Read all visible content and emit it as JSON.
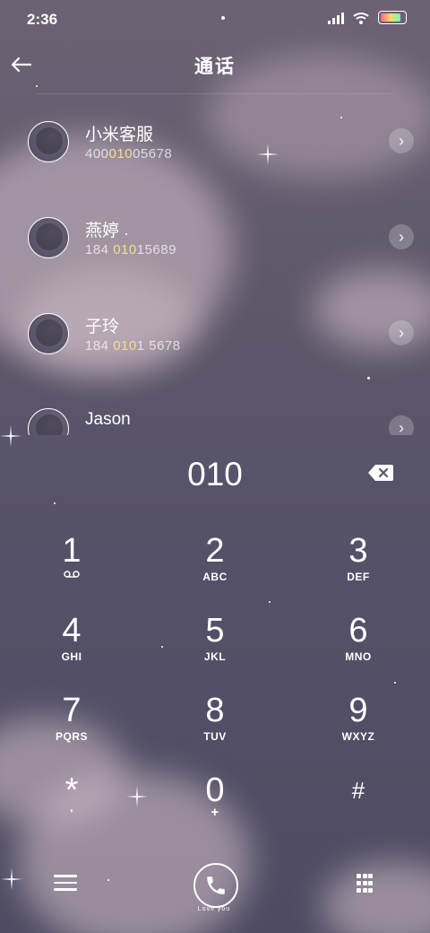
{
  "status_bar": {
    "time": "2:36"
  },
  "header": {
    "title": "通话",
    "back_icon": "arrow-left-icon"
  },
  "contacts": [
    {
      "name": "小米客服",
      "number_pre": "400",
      "number_match": "010",
      "number_post": "05678"
    },
    {
      "name": "燕婷",
      "number_pre": "184 ",
      "number_match": "010",
      "number_post": "15689"
    },
    {
      "name": "子玲",
      "number_pre": "184 ",
      "number_match": "010",
      "number_post": "1 5678"
    },
    {
      "name": "Jason",
      "number_pre": "",
      "number_match": "",
      "number_post": ""
    }
  ],
  "dialer": {
    "input": "010"
  },
  "keypad": [
    {
      "digit": "1",
      "letters": ""
    },
    {
      "digit": "2",
      "letters": "ABC"
    },
    {
      "digit": "3",
      "letters": "DEF"
    },
    {
      "digit": "4",
      "letters": "GHI"
    },
    {
      "digit": "5",
      "letters": "JKL"
    },
    {
      "digit": "6",
      "letters": "MNO"
    },
    {
      "digit": "7",
      "letters": "PQRS"
    },
    {
      "digit": "8",
      "letters": "TUV"
    },
    {
      "digit": "9",
      "letters": "WXYZ"
    },
    {
      "digit": "*",
      "letters": ","
    },
    {
      "digit": "0",
      "letters": "+"
    },
    {
      "digit": "#",
      "letters": ""
    }
  ],
  "bottom_bar": {
    "call_caption": "Love you"
  },
  "colors": {
    "match_highlight": "#f4df89"
  }
}
